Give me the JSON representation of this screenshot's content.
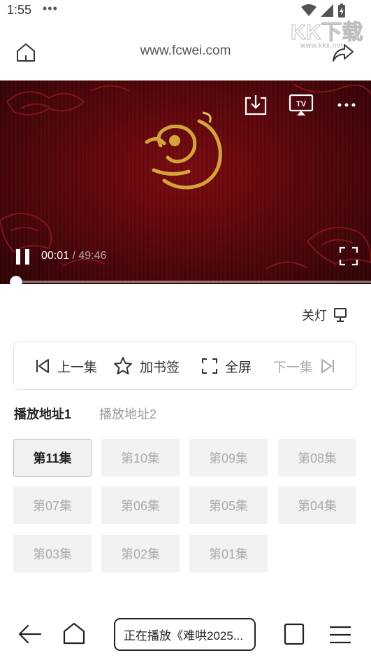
{
  "status_bar": {
    "time": "1:55",
    "dots": "•••",
    "icons": [
      "wifi-icon",
      "signal-icon",
      "battery-charging-icon"
    ]
  },
  "browser": {
    "url": "www.fcwei.com",
    "home_icon": "home-icon",
    "share_icon": "share-icon"
  },
  "player": {
    "current_time": "00:01",
    "separator": "/",
    "duration": "49:46",
    "progress": 0.0003,
    "controls": [
      "download-icon",
      "tv-cast-icon",
      "more-icon",
      "pause-icon",
      "fullscreen-icon"
    ],
    "colors": {
      "bg": "#5a060b",
      "logo_gold": "#d4a43a"
    }
  },
  "light_toggle": {
    "label": "关灯",
    "icon": "lamp-icon"
  },
  "episode_bar": {
    "prev_label": "上一集",
    "bookmark_label": "加书签",
    "fullscreen_label": "全屏",
    "next_label": "下一集"
  },
  "sources": [
    {
      "label": "播放地址1",
      "active": true
    },
    {
      "label": "播放地址2",
      "active": false
    }
  ],
  "episodes": [
    {
      "label": "第11集",
      "active": true
    },
    {
      "label": "第10集",
      "active": false
    },
    {
      "label": "第09集",
      "active": false
    },
    {
      "label": "第08集",
      "active": false
    },
    {
      "label": "第07集",
      "active": false
    },
    {
      "label": "第06集",
      "active": false
    },
    {
      "label": "第05集",
      "active": false
    },
    {
      "label": "第04集",
      "active": false
    },
    {
      "label": "第03集",
      "active": false
    },
    {
      "label": "第02集",
      "active": false
    },
    {
      "label": "第01集",
      "active": false
    }
  ],
  "bottom_nav": {
    "now_playing": "正在播放《难哄2025...",
    "icons": [
      "back-arrow-icon",
      "home-icon",
      "tabs-icon",
      "menu-icon"
    ]
  },
  "watermark": {
    "text": "KK下载",
    "url": "www.kkx.net"
  }
}
